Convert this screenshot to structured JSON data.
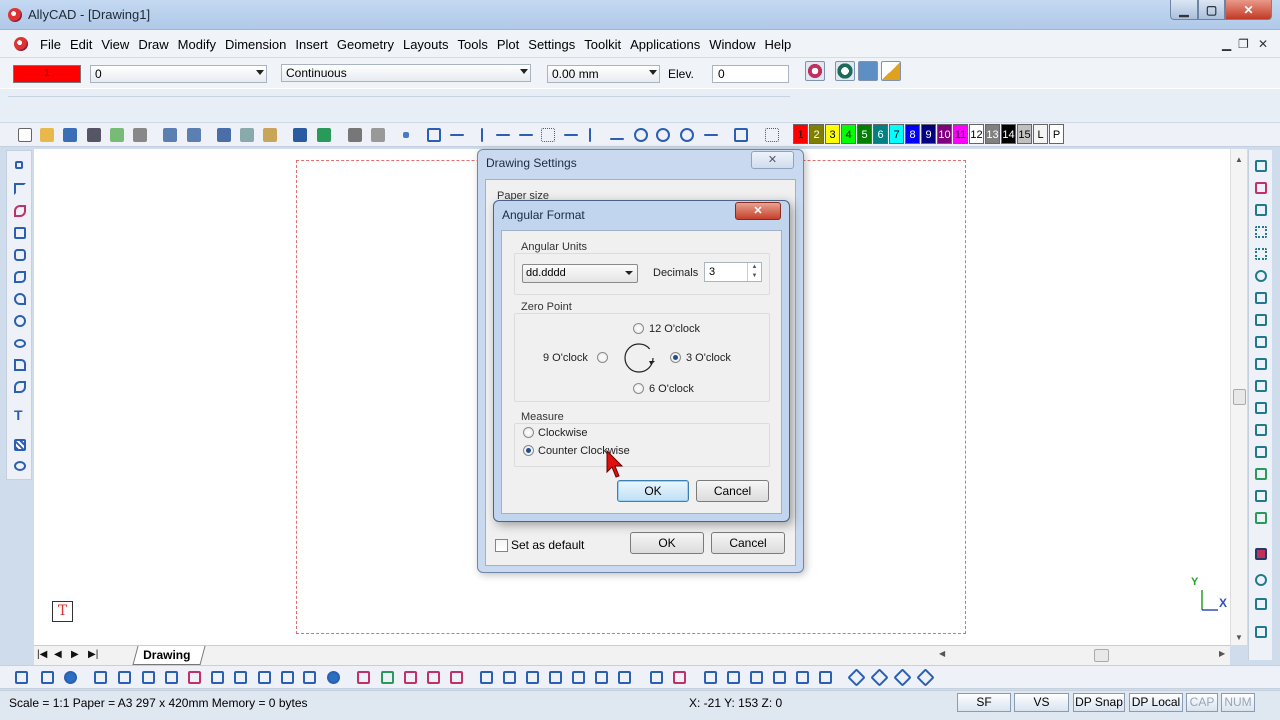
{
  "window": {
    "title": "AllyCAD - [Drawing1]",
    "min": "▁",
    "max": "▢",
    "close": "✕"
  },
  "menu": [
    "File",
    "Edit",
    "View",
    "Draw",
    "Modify",
    "Dimension",
    "Insert",
    "Geometry",
    "Layouts",
    "Tools",
    "Plot",
    "Settings",
    "Toolkit",
    "Applications",
    "Window",
    "Help"
  ],
  "mdi_controls": {
    "min": "▁",
    "restore": "❐",
    "close": "✕"
  },
  "properties": {
    "color_value": "1",
    "layer_value": "0",
    "linetype_value": "Continuous",
    "lineweight_value": "0.00 mm",
    "elev_label": "Elev.",
    "elev_value": "0"
  },
  "color_buttons": [
    {
      "label": "1",
      "color": "#ff0000"
    },
    {
      "label": "2",
      "color": "#808000"
    },
    {
      "label": "3",
      "color": "#ffff00"
    },
    {
      "label": "4",
      "color": "#00ff00"
    },
    {
      "label": "5",
      "color": "#008000"
    },
    {
      "label": "6",
      "color": "#008080"
    },
    {
      "label": "7",
      "color": "#00ffff"
    },
    {
      "label": "8",
      "color": "#0000ff"
    },
    {
      "label": "9",
      "color": "#000080"
    },
    {
      "label": "10",
      "color": "#800080"
    },
    {
      "label": "11",
      "color": "#ff00ff"
    },
    {
      "label": "12",
      "color": "#ffffff"
    },
    {
      "label": "13",
      "color": "#808080"
    },
    {
      "label": "14",
      "color": "#000000"
    },
    {
      "label": "15",
      "color": "#c0c0c0"
    },
    {
      "label": "L",
      "color": "#f4f4f4"
    },
    {
      "label": "P",
      "color": "#ffffff"
    }
  ],
  "canvas": {
    "ucs_icon": "T",
    "axis_y": "Y",
    "axis_x": "X"
  },
  "tabs": {
    "nav": [
      "|◀",
      "◀",
      "▶",
      "▶|"
    ],
    "active": "Drawing"
  },
  "status": {
    "main": "Scale = 1:1  Paper = A3 297 x 420mm  Memory = 0 bytes",
    "coords": "X: -21 Y: 153 Z: 0",
    "buttons": [
      "SF",
      "VS",
      "DP Snap",
      "DP Local",
      "CAP",
      "NUM"
    ]
  },
  "drawing_settings": {
    "title": "Drawing Settings",
    "close": "✕",
    "group_label": "Paper size",
    "set_default_label": "Set as default",
    "ok": "OK",
    "cancel": "Cancel"
  },
  "angular_format": {
    "title": "Angular Format",
    "close": "✕",
    "units_group": "Angular Units",
    "units_value": "dd.dddd",
    "decimals_label": "Decimals",
    "decimals_value": "3",
    "zero_group": "Zero Point",
    "zero_12": "12 O'clock",
    "zero_9": "9 O'clock",
    "zero_3": "3 O'clock",
    "zero_6": "6 O'clock",
    "measure_group": "Measure",
    "clockwise": "Clockwise",
    "counter_clockwise": "Counter Clockwise",
    "ok": "OK",
    "cancel": "Cancel"
  }
}
